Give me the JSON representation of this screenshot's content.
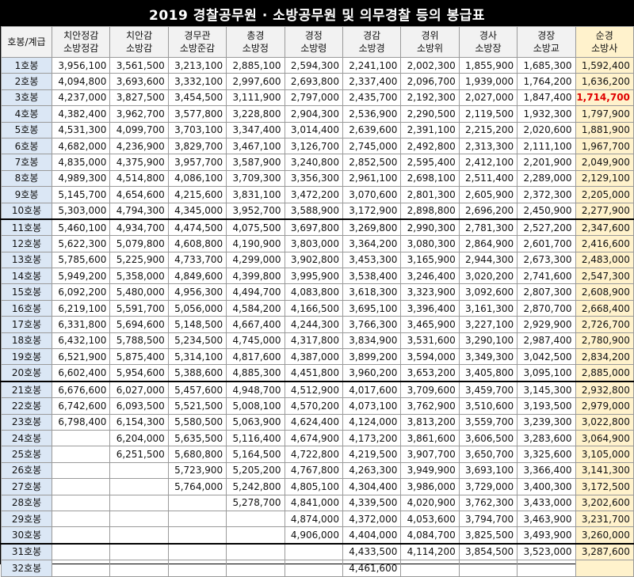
{
  "title": "2019 경찰공무원 · 소방공무원 및 의무경찰 등의 봉급표",
  "header": {
    "step_label": "호봉/계급",
    "ranks": [
      {
        "line1": "치안정감",
        "line2": "소방정감"
      },
      {
        "line1": "치안감",
        "line2": "소방감"
      },
      {
        "line1": "경무관",
        "line2": "소방준감"
      },
      {
        "line1": "총경",
        "line2": "소방정"
      },
      {
        "line1": "경정",
        "line2": "소방령"
      },
      {
        "line1": "경감",
        "line2": "소방경"
      },
      {
        "line1": "경위",
        "line2": "소방위"
      },
      {
        "line1": "경사",
        "line2": "소방장"
      },
      {
        "line1": "경장",
        "line2": "소방교"
      },
      {
        "line1": "순경",
        "line2": "소방사"
      }
    ]
  },
  "rows": [
    {
      "step": "1호봉",
      "values": [
        "3,956,100",
        "3,561,500",
        "3,213,100",
        "2,885,100",
        "2,594,300",
        "2,241,100",
        "2,002,300",
        "1,855,900",
        "1,685,300",
        "1,592,400"
      ]
    },
    {
      "step": "2호봉",
      "values": [
        "4,094,800",
        "3,693,600",
        "3,332,100",
        "2,997,600",
        "2,693,800",
        "2,337,400",
        "2,096,700",
        "1,939,000",
        "1,764,200",
        "1,636,200"
      ]
    },
    {
      "step": "3호봉",
      "values": [
        "4,237,000",
        "3,827,500",
        "3,454,500",
        "3,111,900",
        "2,797,000",
        "2,435,700",
        "2,192,300",
        "2,027,000",
        "1,847,400",
        "1,714,700"
      ]
    },
    {
      "step": "4호봉",
      "values": [
        "4,382,400",
        "3,962,700",
        "3,577,800",
        "3,228,800",
        "2,904,300",
        "2,536,900",
        "2,290,500",
        "2,119,500",
        "1,932,300",
        "1,797,900"
      ]
    },
    {
      "step": "5호봉",
      "values": [
        "4,531,300",
        "4,099,700",
        "3,703,100",
        "3,347,400",
        "3,014,400",
        "2,639,600",
        "2,391,100",
        "2,215,200",
        "2,020,600",
        "1,881,900"
      ]
    },
    {
      "step": "6호봉",
      "values": [
        "4,682,000",
        "4,236,900",
        "3,829,700",
        "3,467,100",
        "3,126,700",
        "2,745,000",
        "2,492,800",
        "2,313,300",
        "2,111,100",
        "1,967,700"
      ]
    },
    {
      "step": "7호봉",
      "values": [
        "4,835,000",
        "4,375,900",
        "3,957,700",
        "3,587,900",
        "3,240,800",
        "2,852,500",
        "2,595,400",
        "2,412,100",
        "2,201,900",
        "2,049,900"
      ]
    },
    {
      "step": "8호봉",
      "values": [
        "4,989,300",
        "4,514,800",
        "4,086,100",
        "3,709,300",
        "3,356,300",
        "2,961,100",
        "2,698,100",
        "2,511,400",
        "2,289,000",
        "2,129,100"
      ]
    },
    {
      "step": "9호봉",
      "values": [
        "5,145,700",
        "4,654,600",
        "4,215,600",
        "3,831,100",
        "3,472,200",
        "3,070,600",
        "2,801,300",
        "2,605,900",
        "2,372,300",
        "2,205,000"
      ]
    },
    {
      "step": "10호봉",
      "values": [
        "5,303,000",
        "4,794,300",
        "4,345,000",
        "3,952,700",
        "3,588,900",
        "3,172,900",
        "2,898,800",
        "2,696,200",
        "2,450,900",
        "2,277,900"
      ]
    },
    {
      "step": "11호봉",
      "values": [
        "5,460,100",
        "4,934,700",
        "4,474,500",
        "4,075,500",
        "3,697,800",
        "3,269,800",
        "2,990,300",
        "2,781,300",
        "2,527,200",
        "2,347,600"
      ]
    },
    {
      "step": "12호봉",
      "values": [
        "5,622,300",
        "5,079,800",
        "4,608,800",
        "4,190,900",
        "3,803,000",
        "3,364,200",
        "3,080,300",
        "2,864,900",
        "2,601,700",
        "2,416,600"
      ]
    },
    {
      "step": "13호봉",
      "values": [
        "5,785,600",
        "5,225,900",
        "4,733,700",
        "4,299,000",
        "3,902,800",
        "3,453,300",
        "3,165,900",
        "2,944,300",
        "2,673,300",
        "2,483,000"
      ]
    },
    {
      "step": "14호봉",
      "values": [
        "5,949,200",
        "5,358,000",
        "4,849,600",
        "4,399,800",
        "3,995,900",
        "3,538,400",
        "3,246,400",
        "3,020,200",
        "2,741,600",
        "2,547,300"
      ]
    },
    {
      "step": "15호봉",
      "values": [
        "6,092,200",
        "5,480,000",
        "4,956,300",
        "4,494,700",
        "4,083,800",
        "3,618,300",
        "3,323,900",
        "3,092,600",
        "2,807,300",
        "2,608,900"
      ]
    },
    {
      "step": "16호봉",
      "values": [
        "6,219,100",
        "5,591,700",
        "5,056,000",
        "4,584,200",
        "4,166,500",
        "3,695,100",
        "3,396,400",
        "3,161,300",
        "2,870,700",
        "2,668,400"
      ]
    },
    {
      "step": "17호봉",
      "values": [
        "6,331,800",
        "5,694,600",
        "5,148,500",
        "4,667,400",
        "4,244,300",
        "3,766,300",
        "3,465,900",
        "3,227,100",
        "2,929,900",
        "2,726,700"
      ]
    },
    {
      "step": "18호봉",
      "values": [
        "6,432,100",
        "5,788,500",
        "5,234,500",
        "4,745,000",
        "4,317,800",
        "3,834,900",
        "3,531,600",
        "3,290,100",
        "2,987,400",
        "2,780,900"
      ]
    },
    {
      "step": "19호봉",
      "values": [
        "6,521,900",
        "5,875,400",
        "5,314,100",
        "4,817,600",
        "4,387,000",
        "3,899,200",
        "3,594,000",
        "3,349,300",
        "3,042,500",
        "2,834,200"
      ]
    },
    {
      "step": "20호봉",
      "values": [
        "6,602,400",
        "5,954,600",
        "5,388,600",
        "4,885,300",
        "4,451,800",
        "3,960,200",
        "3,653,200",
        "3,405,800",
        "3,095,100",
        "2,885,000"
      ]
    },
    {
      "step": "21호봉",
      "values": [
        "6,676,600",
        "6,027,000",
        "5,457,600",
        "4,948,700",
        "4,512,900",
        "4,017,600",
        "3,709,600",
        "3,459,700",
        "3,145,300",
        "2,932,800"
      ]
    },
    {
      "step": "22호봉",
      "values": [
        "6,742,600",
        "6,093,500",
        "5,521,500",
        "5,008,100",
        "4,570,200",
        "4,073,100",
        "3,762,900",
        "3,510,600",
        "3,193,500",
        "2,979,000"
      ]
    },
    {
      "step": "23호봉",
      "values": [
        "6,798,400",
        "6,154,300",
        "5,580,500",
        "5,063,900",
        "4,624,400",
        "4,124,000",
        "3,813,200",
        "3,559,700",
        "3,239,300",
        "3,022,800"
      ]
    },
    {
      "step": "24호봉",
      "values": [
        "",
        "6,204,000",
        "5,635,500",
        "5,116,400",
        "4,674,900",
        "4,173,200",
        "3,861,600",
        "3,606,500",
        "3,283,600",
        "3,064,900"
      ]
    },
    {
      "step": "25호봉",
      "values": [
        "",
        "6,251,500",
        "5,680,800",
        "5,164,500",
        "4,722,800",
        "4,219,500",
        "3,907,700",
        "3,650,700",
        "3,325,600",
        "3,105,000"
      ]
    },
    {
      "step": "26호봉",
      "values": [
        "",
        "",
        "5,723,900",
        "5,205,200",
        "4,767,800",
        "4,263,300",
        "3,949,900",
        "3,693,100",
        "3,366,400",
        "3,141,300"
      ]
    },
    {
      "step": "27호봉",
      "values": [
        "",
        "",
        "5,764,000",
        "5,242,800",
        "4,805,100",
        "4,304,400",
        "3,986,000",
        "3,729,000",
        "3,400,300",
        "3,172,500"
      ]
    },
    {
      "step": "28호봉",
      "values": [
        "",
        "",
        "",
        "5,278,700",
        "4,841,000",
        "4,339,500",
        "4,020,900",
        "3,762,300",
        "3,433,000",
        "3,202,600"
      ]
    },
    {
      "step": "29호봉",
      "values": [
        "",
        "",
        "",
        "",
        "4,874,000",
        "4,372,000",
        "4,053,600",
        "3,794,700",
        "3,463,900",
        "3,231,700"
      ]
    },
    {
      "step": "30호봉",
      "values": [
        "",
        "",
        "",
        "",
        "4,906,000",
        "4,404,000",
        "4,084,700",
        "3,825,500",
        "3,493,900",
        "3,260,000"
      ]
    },
    {
      "step": "31호봉",
      "values": [
        "",
        "",
        "",
        "",
        "",
        "4,433,500",
        "4,114,200",
        "3,854,500",
        "3,523,000",
        "3,287,600"
      ]
    },
    {
      "step": "32호봉",
      "values": [
        "",
        "",
        "",
        "",
        "",
        "4,461,600",
        "",
        "",
        "",
        ""
      ]
    }
  ],
  "highlight": {
    "row": 2,
    "col": 9,
    "color": "#e00000"
  },
  "colors": {
    "title_bg": "#000000",
    "step_bg": "#dbe7f5",
    "last_col_bg": "#fff2cc",
    "header_bg": "#f2f2f2"
  }
}
